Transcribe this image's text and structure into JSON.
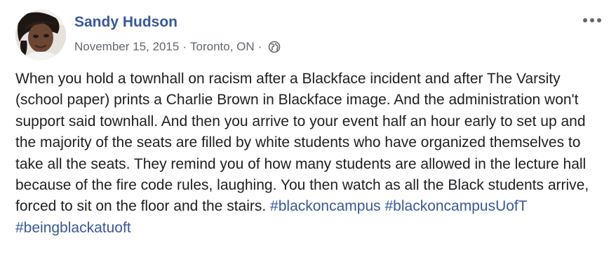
{
  "post": {
    "author": "Sandy Hudson",
    "date": "November 15, 2015",
    "separator": "·",
    "location": "Toronto, ON",
    "privacy_icon": "globe-icon",
    "more_icon": "more-options-icon",
    "body_text": "When you hold a townhall on racism after a Blackface incident and after The Varsity (school paper) prints a Charlie Brown in Blackface image. And the administration won't support said townhall. And then you arrive to your event half an hour early to set up and the majority of the seats are filled by white students who have organized themselves to take all the seats. They remind you of how many students are allowed in the lecture hall because of the fire code rules, laughing. You then watch as all the Black students arrive, forced to sit on the floor and the stairs.",
    "hashtags": [
      "#blackoncampus",
      "#blackoncampusUofT",
      "#beingblackatuoft"
    ]
  },
  "colors": {
    "link": "#385898",
    "text": "#1c1e21",
    "meta": "#616770"
  }
}
